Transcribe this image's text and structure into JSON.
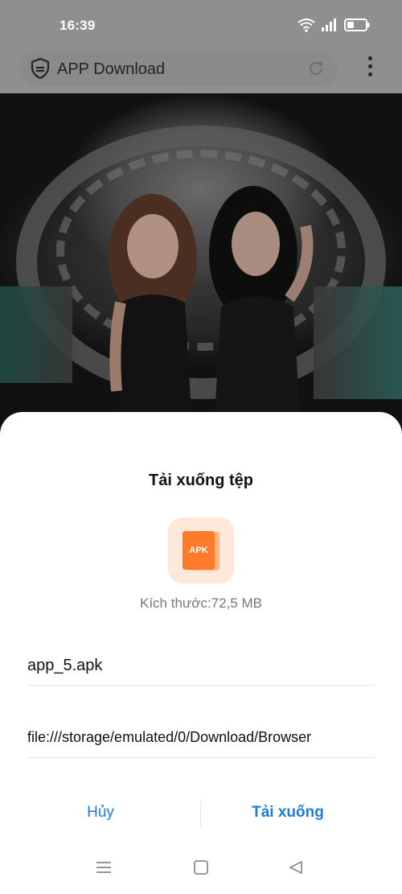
{
  "status_bar": {
    "time": "16:39",
    "icons": [
      "wifi-icon",
      "signal-icon",
      "battery-icon"
    ]
  },
  "browser": {
    "title": "APP Download",
    "icons": [
      "shield-icon",
      "reload-icon",
      "more-vert-icon"
    ]
  },
  "dialog": {
    "title": "Tải xuống tệp",
    "file_icon_label": "APK",
    "size_text": "Kích thước:72,5 MB",
    "filename": "app_5.apk",
    "path": "file:///storage/emulated/0/Download/Browser",
    "cancel_label": "Hủy",
    "download_label": "Tải xuống"
  },
  "navbar": {
    "icons": [
      "menu-icon",
      "home-icon",
      "back-icon"
    ]
  },
  "colors": {
    "accent": "#1f7bd8",
    "apk_orange": "#ff7a2a",
    "apk_tile_bg": "#fde9dc",
    "dim_overlay": "#8f8f8f"
  }
}
